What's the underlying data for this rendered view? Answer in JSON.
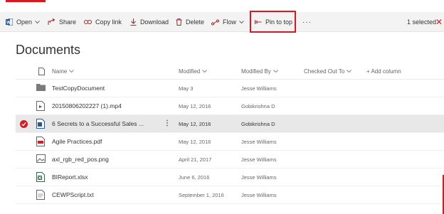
{
  "command_bar": {
    "open": "Open",
    "share": "Share",
    "copy_link": "Copy link",
    "download": "Download",
    "delete": "Delete",
    "flow": "Flow",
    "pin_to_top": "Pin to top",
    "more": "···",
    "selected": "1 selected"
  },
  "page": {
    "title": "Documents"
  },
  "columns": {
    "name": "Name",
    "modified": "Modified",
    "modified_by": "Modified By",
    "checked_out_to": "Checked Out To",
    "add_column": "+ Add column"
  },
  "rows": [
    {
      "name": "TestCopyDocument",
      "modified": "May 3",
      "modified_by": "Jesse Williams",
      "icon": "folder-icon"
    },
    {
      "name": "20150806202227 (1).mp4",
      "modified": "May 12, 2016",
      "modified_by": "Gobikrishna D",
      "icon": "video-file-icon"
    },
    {
      "name": "6 Secrets to a Successful Sales ...",
      "modified": "May 12, 2016",
      "modified_by": "Gobikrishna D",
      "icon": "word-file-icon",
      "selected": true
    },
    {
      "name": "Agile Practices.pdf",
      "modified": "May 12, 2016",
      "modified_by": "Jesse Williams",
      "icon": "pdf-file-icon"
    },
    {
      "name": "axl_rgb_red_pos.png",
      "modified": "April 21, 2017",
      "modified_by": "Jesse Williams",
      "icon": "image-file-icon"
    },
    {
      "name": "BIReport.xlsx",
      "modified": "June 6, 2016",
      "modified_by": "Jesse Williams",
      "icon": "excel-file-icon"
    },
    {
      "name": "CEWPScript.txt",
      "modified": "September 1, 2016",
      "modified_by": "Jesse Williams",
      "icon": "text-file-icon"
    }
  ],
  "colors": {
    "accent": "#d71921",
    "word_blue": "#2b579a",
    "excel_green": "#217346",
    "selected_row": "#e8e8e8",
    "command_bar": "#f3f3f3"
  }
}
